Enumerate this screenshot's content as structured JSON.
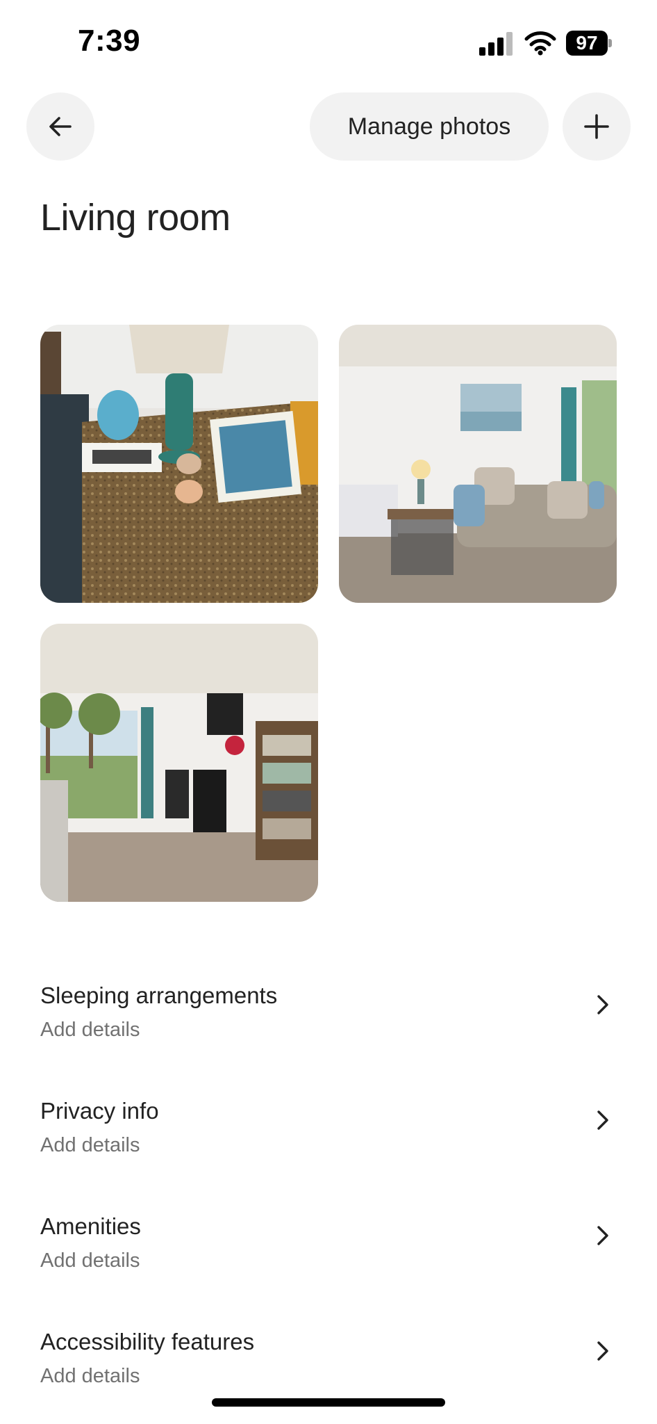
{
  "status_bar": {
    "time": "7:39",
    "battery": "97"
  },
  "header": {
    "manage_photos_label": "Manage photos",
    "title": "Living room"
  },
  "photos": [
    {
      "description": "Side table with lamp, ceramic decor and fish chart"
    },
    {
      "description": "Living area with sofa, side table lamp and ocean painting"
    },
    {
      "description": "Open living room with sliding doors, chairs and bookshelf"
    }
  ],
  "detail_rows": [
    {
      "title": "Sleeping arrangements",
      "subtitle": "Add details"
    },
    {
      "title": "Privacy info",
      "subtitle": "Add details"
    },
    {
      "title": "Amenities",
      "subtitle": "Add details"
    },
    {
      "title": "Accessibility features",
      "subtitle": "Add details"
    }
  ],
  "icons": {
    "back": "arrow-left-icon",
    "add": "plus-icon",
    "chevron": "chevron-right-icon"
  },
  "colors": {
    "button_bg": "#f2f2f2",
    "text_primary": "#222222",
    "text_secondary": "#717171"
  }
}
